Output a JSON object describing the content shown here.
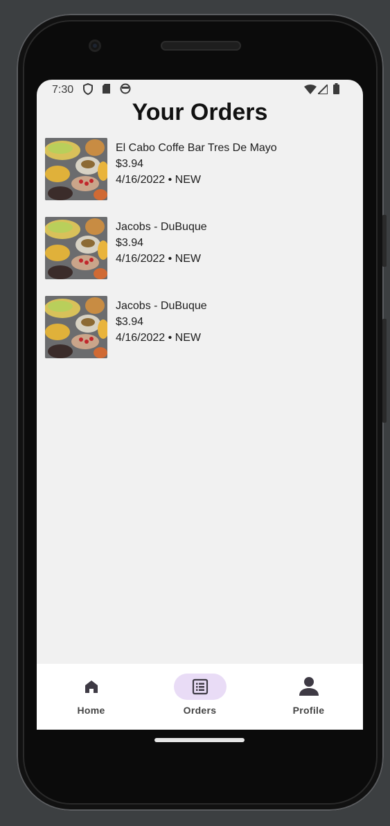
{
  "status_bar": {
    "time": "7:30",
    "left_icons": [
      "shield-icon",
      "sd-card-icon",
      "sync-icon"
    ],
    "right_icons": [
      "wifi-icon",
      "signal-icon",
      "battery-icon"
    ]
  },
  "page": {
    "title": "Your Orders"
  },
  "orders": [
    {
      "restaurant": "El Cabo Coffe Bar Tres De Mayo",
      "price": "$3.94",
      "meta": "4/16/2022 • NEW"
    },
    {
      "restaurant": "Jacobs - DuBuque",
      "price": "$3.94",
      "meta": "4/16/2022 • NEW"
    },
    {
      "restaurant": "Jacobs - DuBuque",
      "price": "$3.94",
      "meta": "4/16/2022 • NEW"
    }
  ],
  "bottom_nav": {
    "items": [
      {
        "label": "Home",
        "icon": "home-icon",
        "active": false
      },
      {
        "label": "Orders",
        "icon": "orders-list-icon",
        "active": true
      },
      {
        "label": "Profile",
        "icon": "profile-icon",
        "active": false
      }
    ],
    "active_color": "#e9dcf6"
  }
}
